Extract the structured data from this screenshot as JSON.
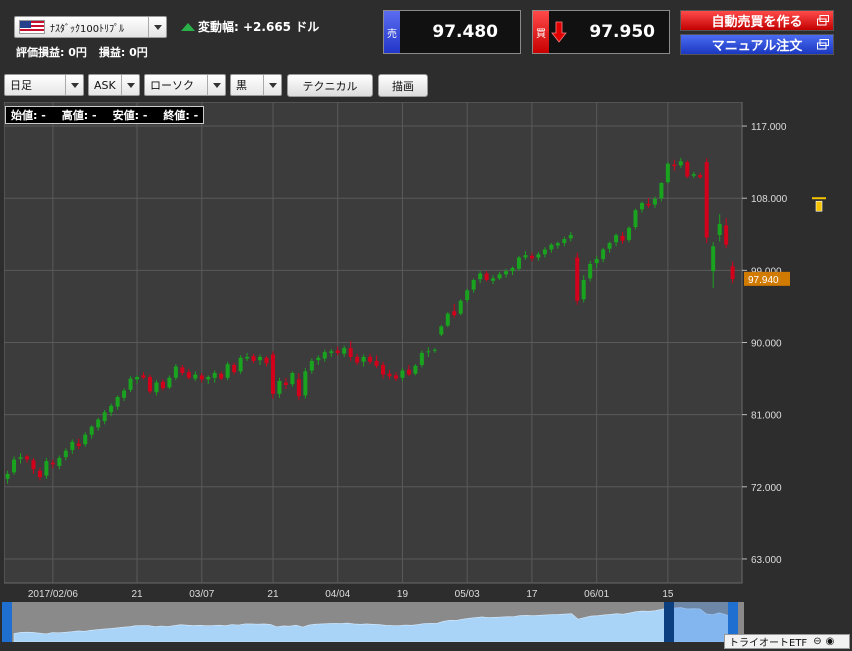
{
  "header": {
    "symbol": "ﾅｽﾀﾞｯｸ100ﾄﾘﾌﾟﾙ",
    "change_label": "変動幅:",
    "change_value": "+2.665 ドル",
    "valuation_label": "評価損益:",
    "valuation_value": "0円",
    "pnl_label": "損益:",
    "pnl_value": "0円",
    "sell_tag": "売",
    "sell_price": "97.480",
    "buy_tag": "買",
    "buy_price": "97.950",
    "auto_trade_button": "自動売買を作る",
    "manual_order_button": "マニュアル注文"
  },
  "toolbar": {
    "period": "日足",
    "side": "ASK",
    "chart_type": "ローソク",
    "theme": "黒",
    "technical_button": "テクニカル",
    "draw_button": "描画"
  },
  "ohlc_bar": {
    "open": "始値: -",
    "high": "高値: -",
    "low": "安値: -",
    "close": "終値: -"
  },
  "footer": {
    "instrument_label": "トライオートETF"
  },
  "colors": {
    "background": "#2d2d2d",
    "grid": "#5a5a5a",
    "up_candle": "#19a31f",
    "down_candle": "#d3001b",
    "current_price_badge": "#d17a00",
    "navigator_fill": "#a9d3f7",
    "navigator_handle": "#1f6fd0",
    "marker": "#f5c300"
  },
  "chart_data": {
    "type": "candlestick",
    "ylim": [
      60.0,
      120.0
    ],
    "y_ticks": [
      "117.000",
      "108.000",
      "99.000",
      "90.000",
      "81.000",
      "72.000",
      "63.000"
    ],
    "y_tick_values": [
      117,
      108,
      99,
      90,
      81,
      72,
      63
    ],
    "x_ticks": [
      "2017/02/06",
      "21",
      "03/07",
      "21",
      "04/04",
      "19",
      "05/03",
      "17",
      "06/01",
      "15"
    ],
    "current_price": "97.940",
    "current_price_value": 97.94,
    "candles": [
      [
        73.0,
        74.0,
        72.4,
        73.6
      ],
      [
        73.8,
        75.8,
        73.5,
        75.4
      ],
      [
        75.5,
        76.2,
        74.9,
        75.7
      ],
      [
        75.8,
        76.0,
        75.0,
        75.4
      ],
      [
        75.3,
        75.6,
        73.6,
        74.2
      ],
      [
        74.0,
        74.4,
        72.8,
        73.2
      ],
      [
        73.4,
        75.6,
        73.0,
        75.2
      ],
      [
        75.0,
        75.4,
        74.3,
        74.8
      ],
      [
        74.6,
        75.9,
        74.2,
        75.6
      ],
      [
        75.7,
        76.8,
        75.3,
        76.5
      ],
      [
        76.6,
        77.9,
        76.1,
        77.6
      ],
      [
        77.4,
        78.0,
        76.7,
        77.1
      ],
      [
        77.3,
        78.8,
        77.0,
        78.5
      ],
      [
        78.5,
        79.7,
        78.0,
        79.5
      ],
      [
        79.4,
        80.6,
        79.0,
        80.4
      ],
      [
        80.2,
        81.6,
        79.8,
        81.3
      ],
      [
        81.3,
        82.4,
        80.8,
        82.1
      ],
      [
        82.0,
        83.4,
        81.6,
        83.2
      ],
      [
        83.1,
        84.3,
        82.7,
        84.0
      ],
      [
        84.1,
        85.8,
        83.8,
        85.5
      ],
      [
        85.4,
        85.9,
        84.8,
        85.7
      ],
      [
        85.9,
        86.3,
        85.4,
        85.6
      ],
      [
        85.7,
        86.0,
        83.6,
        83.9
      ],
      [
        83.8,
        85.3,
        83.4,
        85.0
      ],
      [
        85.1,
        85.4,
        84.0,
        84.3
      ],
      [
        84.4,
        85.9,
        84.2,
        85.6
      ],
      [
        85.6,
        87.3,
        85.3,
        87.0
      ],
      [
        86.9,
        87.2,
        85.9,
        86.2
      ],
      [
        86.3,
        86.7,
        85.4,
        85.6
      ],
      [
        85.5,
        86.4,
        85.2,
        86.0
      ],
      [
        85.9,
        86.2,
        85.0,
        85.4
      ],
      [
        85.4,
        85.9,
        84.8,
        85.7
      ],
      [
        85.6,
        86.5,
        85.0,
        86.2
      ],
      [
        86.1,
        86.4,
        85.3,
        85.5
      ],
      [
        85.6,
        87.6,
        85.3,
        87.3
      ],
      [
        87.2,
        87.5,
        86.0,
        86.3
      ],
      [
        86.4,
        88.4,
        86.1,
        88.1
      ],
      [
        88.0,
        88.7,
        87.7,
        88.2
      ],
      [
        88.3,
        88.6,
        87.4,
        87.7
      ],
      [
        87.8,
        88.5,
        87.2,
        88.2
      ],
      [
        88.1,
        88.3,
        87.0,
        87.4
      ],
      [
        88.5,
        88.9,
        83.0,
        83.6
      ],
      [
        83.6,
        85.6,
        83.1,
        85.2
      ],
      [
        85.0,
        85.6,
        84.2,
        84.7
      ],
      [
        84.8,
        86.4,
        84.5,
        86.2
      ],
      [
        85.4,
        86.2,
        82.8,
        83.3
      ],
      [
        83.4,
        86.8,
        83.0,
        86.4
      ],
      [
        86.5,
        88.0,
        86.1,
        87.7
      ],
      [
        87.8,
        88.4,
        87.2,
        88.1
      ],
      [
        88.0,
        89.1,
        87.6,
        88.8
      ],
      [
        88.7,
        89.2,
        88.2,
        88.9
      ],
      [
        89.0,
        89.5,
        88.4,
        88.7
      ],
      [
        88.6,
        89.6,
        88.2,
        89.3
      ],
      [
        89.3,
        90.2,
        87.7,
        88.2
      ],
      [
        88.2,
        88.6,
        87.2,
        87.5
      ],
      [
        87.6,
        88.5,
        87.0,
        88.2
      ],
      [
        88.2,
        88.6,
        87.3,
        87.6
      ],
      [
        87.7,
        88.4,
        86.8,
        87.1
      ],
      [
        87.2,
        87.6,
        85.5,
        86.0
      ],
      [
        86.1,
        86.6,
        85.4,
        85.8
      ],
      [
        85.9,
        86.3,
        85.2,
        85.5
      ],
      [
        85.6,
        86.8,
        85.2,
        86.5
      ],
      [
        86.6,
        87.2,
        85.8,
        86.0
      ],
      [
        86.1,
        87.3,
        85.9,
        87.1
      ],
      [
        87.2,
        89.0,
        86.9,
        88.7
      ],
      [
        88.8,
        89.4,
        88.2,
        88.9
      ],
      [
        89.0,
        89.3,
        88.7,
        89.1
      ],
      [
        91.0,
        92.2,
        90.8,
        92.0
      ],
      [
        92.1,
        93.8,
        91.9,
        93.6
      ],
      [
        93.9,
        94.8,
        93.1,
        93.4
      ],
      [
        93.6,
        95.4,
        93.4,
        95.2
      ],
      [
        95.3,
        96.7,
        95.0,
        96.5
      ],
      [
        96.6,
        98.0,
        96.2,
        97.8
      ],
      [
        97.9,
        98.9,
        97.4,
        98.6
      ],
      [
        98.6,
        98.9,
        97.6,
        97.8
      ],
      [
        97.7,
        98.4,
        97.3,
        98.0
      ],
      [
        98.0,
        98.8,
        97.8,
        98.5
      ],
      [
        98.5,
        99.2,
        98.1,
        98.9
      ],
      [
        98.9,
        99.5,
        98.4,
        99.3
      ],
      [
        99.2,
        100.8,
        99.0,
        100.6
      ],
      [
        100.6,
        101.4,
        100.3,
        100.9
      ],
      [
        100.8,
        101.2,
        100.1,
        100.5
      ],
      [
        100.6,
        101.3,
        100.2,
        101.0
      ],
      [
        101.0,
        101.9,
        100.6,
        101.6
      ],
      [
        101.6,
        102.4,
        101.2,
        102.2
      ],
      [
        102.1,
        102.6,
        101.7,
        102.4
      ],
      [
        102.4,
        103.2,
        102.0,
        102.9
      ],
      [
        103.0,
        103.8,
        102.6,
        103.4
      ],
      [
        100.6,
        101.2,
        94.7,
        95.2
      ],
      [
        95.4,
        98.4,
        95.0,
        97.8
      ],
      [
        98.0,
        100.2,
        97.6,
        99.8
      ],
      [
        99.9,
        100.8,
        99.3,
        100.4
      ],
      [
        100.4,
        101.8,
        100.0,
        101.6
      ],
      [
        101.7,
        102.6,
        101.2,
        102.4
      ],
      [
        102.5,
        103.6,
        102.0,
        103.4
      ],
      [
        103.3,
        103.8,
        102.3,
        102.7
      ],
      [
        102.8,
        104.5,
        102.5,
        104.3
      ],
      [
        104.4,
        106.7,
        104.1,
        106.5
      ],
      [
        106.6,
        107.6,
        106.2,
        107.4
      ],
      [
        107.3,
        108.0,
        106.8,
        107.1
      ],
      [
        107.2,
        108.2,
        106.8,
        107.9
      ],
      [
        108.0,
        110.0,
        107.6,
        109.9
      ],
      [
        110.0,
        112.5,
        109.8,
        112.3
      ],
      [
        112.2,
        112.8,
        111.4,
        112.0
      ],
      [
        112.1,
        113.0,
        111.8,
        112.6
      ],
      [
        112.5,
        112.7,
        110.5,
        110.7
      ],
      [
        110.8,
        111.3,
        110.5,
        111.0
      ],
      [
        110.9,
        111.2,
        110.4,
        110.6
      ],
      [
        112.5,
        113.0,
        102.4,
        103.1
      ],
      [
        98.9,
        102.5,
        96.8,
        102.0
      ],
      [
        103.4,
        106.0,
        102.6,
        104.8
      ],
      [
        104.6,
        105.5,
        101.8,
        102.2
      ],
      [
        99.5,
        100.1,
        97.4,
        97.9
      ]
    ]
  }
}
